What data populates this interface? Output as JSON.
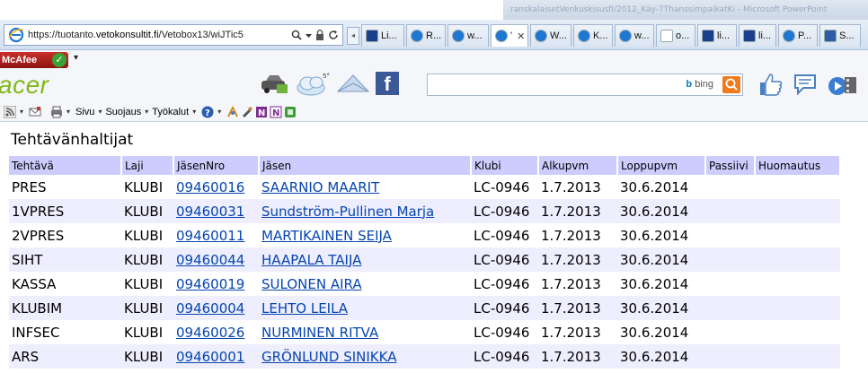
{
  "browser": {
    "blur_title": "ranskalaisetVenkuskisusfi/2012_Käy-7ThanssimpaikatKi - Microsoft PowerPoint",
    "address_url_prefix": "https://tuotanto.",
    "address_url_domain": "vetokonsultit.fi",
    "address_url_path": "/Vetobox13/wiJTic5",
    "tab_scroll_left": "◂",
    "tabs": [
      {
        "label": "Li...",
        "active": false,
        "icon": "lions-icon"
      },
      {
        "label": "R...",
        "active": false,
        "icon": "ie-icon"
      },
      {
        "label": "w...",
        "active": false,
        "icon": "ie-icon"
      },
      {
        "label": "'",
        "active": true,
        "icon": "ie-icon"
      },
      {
        "label": "W...",
        "active": false,
        "icon": "ie-icon"
      },
      {
        "label": "K...",
        "active": false,
        "icon": "ie-icon"
      },
      {
        "label": "w...",
        "active": false,
        "icon": "ie-icon"
      },
      {
        "label": "o...",
        "active": false,
        "icon": "blank-page-icon"
      },
      {
        "label": "li...",
        "active": false,
        "icon": "lions-icon"
      },
      {
        "label": "li...",
        "active": false,
        "icon": "lions-icon"
      },
      {
        "label": "P...",
        "active": false,
        "icon": "ie-icon"
      },
      {
        "label": "S...",
        "active": false,
        "icon": "flag-icon"
      }
    ],
    "tab_close": "✕"
  },
  "toolbar": {
    "mcafee_label": "McAfee",
    "mcafee_check": "✓",
    "mcafee_drop": "▾",
    "acer_logo": "acer",
    "bing_label_b": "b",
    "bing_label": "bing",
    "menus": [
      {
        "label": "Sivu",
        "dd": "▾"
      },
      {
        "label": "Suojaus",
        "dd": "▾"
      },
      {
        "label": "Työkalut",
        "dd": "▾"
      }
    ],
    "help_dd": "▾"
  },
  "page": {
    "title": "Tehtävänhaltijat",
    "columns": [
      "Tehtävä",
      "Laji",
      "JäsenNro",
      "Jäsen",
      "Klubi",
      "Alkupvm",
      "Loppupvm",
      "Passiivi",
      "Huomautus"
    ],
    "rows": [
      {
        "tehtava": "PRES",
        "laji": "KLUBI",
        "nro": "09460016",
        "jasen": "SAARNIO MAARIT",
        "klubi": "LC-0946",
        "alku": "1.7.2013",
        "loppu": "30.6.2014",
        "passiivi": "",
        "huom": ""
      },
      {
        "tehtava": "1VPRES",
        "laji": "KLUBI",
        "nro": "09460031",
        "jasen": "Sundström-Pullinen Marja",
        "klubi": "LC-0946",
        "alku": "1.7.2013",
        "loppu": "30.6.2014",
        "passiivi": "",
        "huom": ""
      },
      {
        "tehtava": "2VPRES",
        "laji": "KLUBI",
        "nro": "09460011",
        "jasen": "MARTIKAINEN SEIJA",
        "klubi": "LC-0946",
        "alku": "1.7.2013",
        "loppu": "30.6.2014",
        "passiivi": "",
        "huom": ""
      },
      {
        "tehtava": "SIHT",
        "laji": "KLUBI",
        "nro": "09460044",
        "jasen": "HAAPALA TAIJA",
        "klubi": "LC-0946",
        "alku": "1.7.2013",
        "loppu": "30.6.2014",
        "passiivi": "",
        "huom": ""
      },
      {
        "tehtava": "KASSA",
        "laji": "KLUBI",
        "nro": "09460019",
        "jasen": "SULONEN AIRA",
        "klubi": "LC-0946",
        "alku": "1.7.2013",
        "loppu": "30.6.2014",
        "passiivi": "",
        "huom": ""
      },
      {
        "tehtava": "KLUBIM",
        "laji": "KLUBI",
        "nro": "09460004",
        "jasen": "LEHTO LEILA",
        "klubi": "LC-0946",
        "alku": "1.7.2013",
        "loppu": "30.6.2014",
        "passiivi": "",
        "huom": ""
      },
      {
        "tehtava": "INFSEC",
        "laji": "KLUBI",
        "nro": "09460026",
        "jasen": "NURMINEN RITVA",
        "klubi": "LC-0946",
        "alku": "1.7.2013",
        "loppu": "30.6.2014",
        "passiivi": "",
        "huom": ""
      },
      {
        "tehtava": "ARS",
        "laji": "KLUBI",
        "nro": "09460001",
        "jasen": "GRÖNLUND SINIKKA",
        "klubi": "LC-0946",
        "alku": "1.7.2013",
        "loppu": "30.6.2014",
        "passiivi": "",
        "huom": ""
      }
    ]
  },
  "colors": {
    "header_bg": "#ccccff",
    "alt_row_bg": "#eeeeff",
    "link": "#0645ad",
    "acer_green": "#83b81a",
    "mcafee_red": "#c9302c"
  }
}
